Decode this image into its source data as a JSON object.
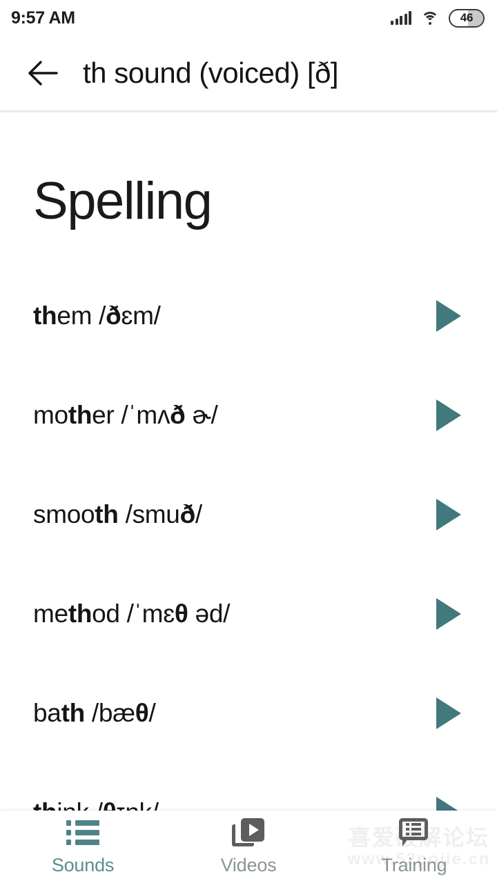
{
  "status_bar": {
    "time": "9:57 AM",
    "signal_icon": "signal-bars-icon",
    "wifi_icon": "wifi-icon",
    "battery_level": "46"
  },
  "app_bar": {
    "back_icon": "back-arrow-icon",
    "title": "th sound (voiced) [ð]"
  },
  "content": {
    "section_title": "Spelling",
    "words": [
      {
        "pre": "",
        "bold": "th",
        "post": "em /",
        "ipa_bold": "ð",
        "ipa_post": "ɛm/",
        "play_label": "play"
      },
      {
        "pre": "mo",
        "bold": "th",
        "post": "er /ˈmʌ",
        "ipa_bold": "ð",
        "ipa_post": " ɚ/",
        "play_label": "play"
      },
      {
        "pre": "smoo",
        "bold": "th",
        "post": " /smu",
        "ipa_bold": "ð",
        "ipa_post": "/",
        "play_label": "play"
      },
      {
        "pre": "me",
        "bold": "th",
        "post": "od /ˈmɛ",
        "ipa_bold": "θ",
        "ipa_post": " əd/",
        "play_label": "play"
      },
      {
        "pre": "ba",
        "bold": "th",
        "post": " /bæ",
        "ipa_bold": "θ",
        "ipa_post": "/",
        "play_label": "play"
      },
      {
        "pre": "",
        "bold": "th",
        "post": "ink /",
        "ipa_bold": "θ",
        "ipa_post": "ɪŋk/",
        "play_label": "play"
      }
    ]
  },
  "bottom_nav": {
    "items": [
      {
        "label": "Sounds",
        "icon": "list-icon",
        "active": true
      },
      {
        "label": "Videos",
        "icon": "video-library-icon",
        "active": false
      },
      {
        "label": "Training",
        "icon": "speech-bubble-list-icon",
        "active": false
      }
    ]
  },
  "watermark": {
    "line1": "喜爱破解论坛",
    "line2": "www.52pojie.cn"
  },
  "colors": {
    "accent_teal": "#41797c",
    "nav_active": "#5b8e90",
    "nav_inactive": "#8a9496",
    "text_primary": "#151515"
  }
}
